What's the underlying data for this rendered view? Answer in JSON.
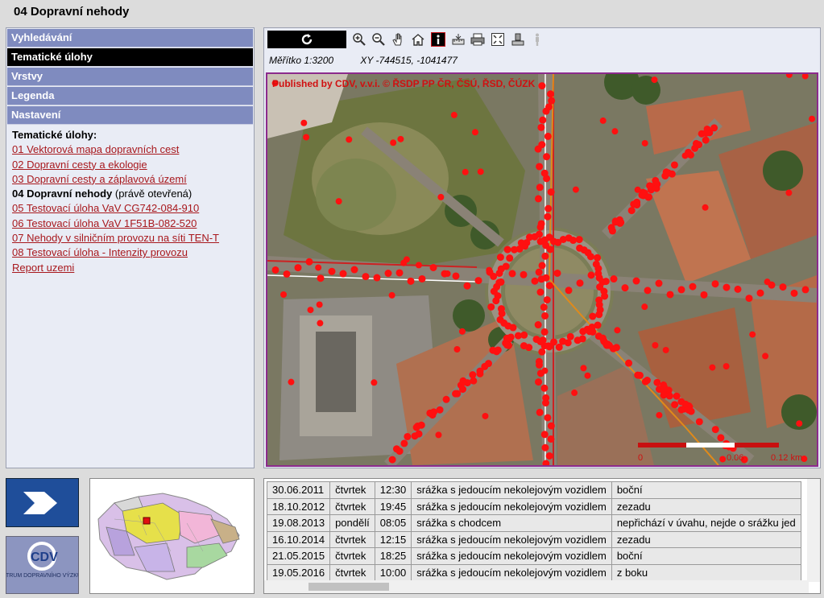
{
  "page": {
    "title": "04 Dopravní nehody"
  },
  "accordion": [
    {
      "label": "Vyhledávání",
      "active": false
    },
    {
      "label": "Tematické úlohy",
      "active": true
    },
    {
      "label": "Vrstvy",
      "active": false
    },
    {
      "label": "Legenda",
      "active": false
    },
    {
      "label": "Nastavení",
      "active": false
    }
  ],
  "tasks": {
    "heading": "Tematické úlohy:",
    "links": [
      "01 Vektorová mapa dopravních cest",
      "02 Dopravní cesty a ekologie",
      "03 Dopravní cesty a záplavová území"
    ],
    "current_name": "04 Dopravní nehody",
    "current_note": " (právě otevřená)",
    "links_after": [
      "05 Testovací úloha VaV CG742-084-910",
      "06 Testovací úloha VaV 1F51B-082-520",
      "07 Nehody v silničním provozu na síti TEN-T",
      "08 Testovací úloha - Intenzity provozu",
      "Report uzemi"
    ]
  },
  "toolbar": {
    "icons": [
      "refresh-icon",
      "zoom-in-icon",
      "zoom-out-icon",
      "pan-hand-icon",
      "home-icon",
      "info-icon",
      "measure-icon",
      "print-icon",
      "fullextent-icon",
      "export-icon",
      "streetview-icon"
    ]
  },
  "mapinfo": {
    "scale": "Měřítko 1:3200",
    "coords": "XY -744515, -1041477",
    "credit": "Published by CDV, v.v.i. © ŘSDP PP ČR, ČSÚ, ŘSD, ČÚZK",
    "scalebar_labels": [
      "0",
      "0.06",
      "0.12 km"
    ]
  },
  "accidents": [
    [
      "30.06.2011",
      "čtvrtek",
      "12:30",
      "srážka s jedoucím nekolejovým vozidlem",
      "boční"
    ],
    [
      "18.10.2012",
      "čtvrtek",
      "19:45",
      "srážka s jedoucím nekolejovým vozidlem",
      "zezadu"
    ],
    [
      "19.08.2013",
      "pondělí",
      "08:05",
      "srážka s chodcem",
      "nepřichází v úvahu, nejde o srážku jed"
    ],
    [
      "16.10.2014",
      "čtvrtek",
      "12:15",
      "srážka s jedoucím nekolejovým vozidlem",
      "zezadu"
    ],
    [
      "21.05.2015",
      "čtvrtek",
      "18:25",
      "srážka s jedoucím nekolejovým vozidlem",
      "boční"
    ],
    [
      "19.05.2016",
      "čtvrtek",
      "10:00",
      "srážka s jedoucím nekolejovým vozidlem",
      "z boku"
    ]
  ],
  "logos": {
    "cdv_text": "CENTRUM DOPRAVNÍHO VÝZKUMU"
  },
  "colors": {
    "accent": "#7f8bbf",
    "link": "#a8181d",
    "accident_dot": "#ff0000",
    "map_border": "#8c2a8c"
  }
}
